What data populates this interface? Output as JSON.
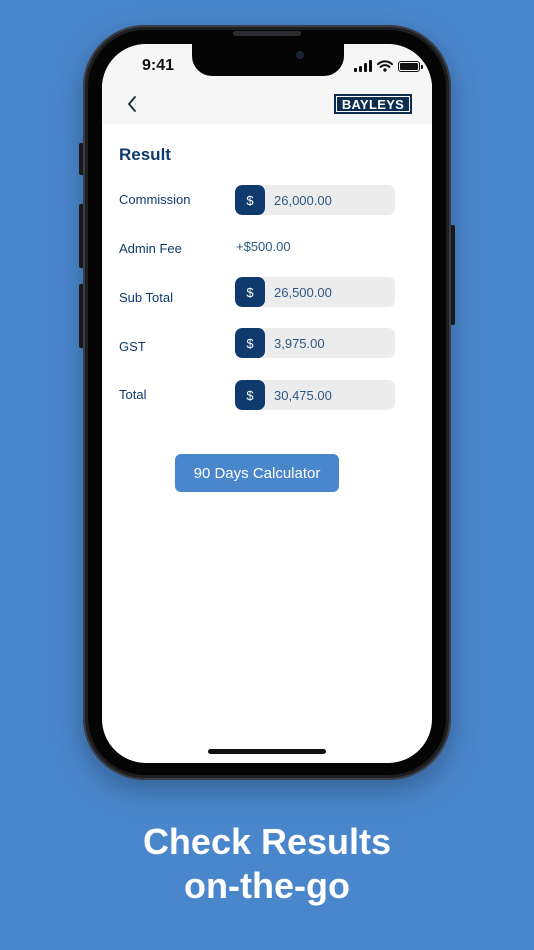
{
  "status_bar": {
    "time": "9:41",
    "icons": [
      "cellular-signal-icon",
      "wifi-icon",
      "battery-icon"
    ]
  },
  "nav": {
    "back_icon": "chevron-left-icon",
    "logo_text": "BAYLEYS"
  },
  "result": {
    "title": "Result",
    "currency_symbol": "$",
    "rows": {
      "commission": {
        "label": "Commission",
        "value": "26,000.00"
      },
      "admin_fee": {
        "label": "Admin Fee",
        "value": "+$500.00"
      },
      "sub_total": {
        "label": "Sub Total",
        "value": "26,500.00"
      },
      "gst": {
        "label": "GST",
        "value": "3,975.00"
      },
      "total": {
        "label": "Total",
        "value": "30,475.00"
      }
    },
    "button_label": "90 Days Calculator"
  },
  "caption": {
    "line1": "Check Results",
    "line2": "on-the-go"
  },
  "colors": {
    "background": "#4a86cc",
    "primary_navy": "#0e3a6e",
    "field_bg": "#ececec",
    "button": "#4a86cc"
  }
}
